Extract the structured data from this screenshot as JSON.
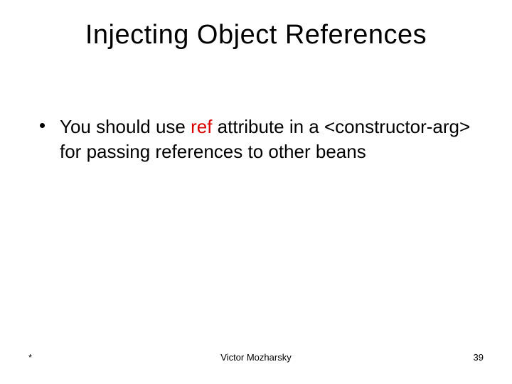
{
  "title": "Injecting Object References",
  "bullet": {
    "pre": "You should use ",
    "ref": "ref",
    "mid": " attribute in a <constructor-arg> for passing references to other beans"
  },
  "footer": {
    "left": "*",
    "center": "Victor Mozharsky",
    "right": "39"
  }
}
